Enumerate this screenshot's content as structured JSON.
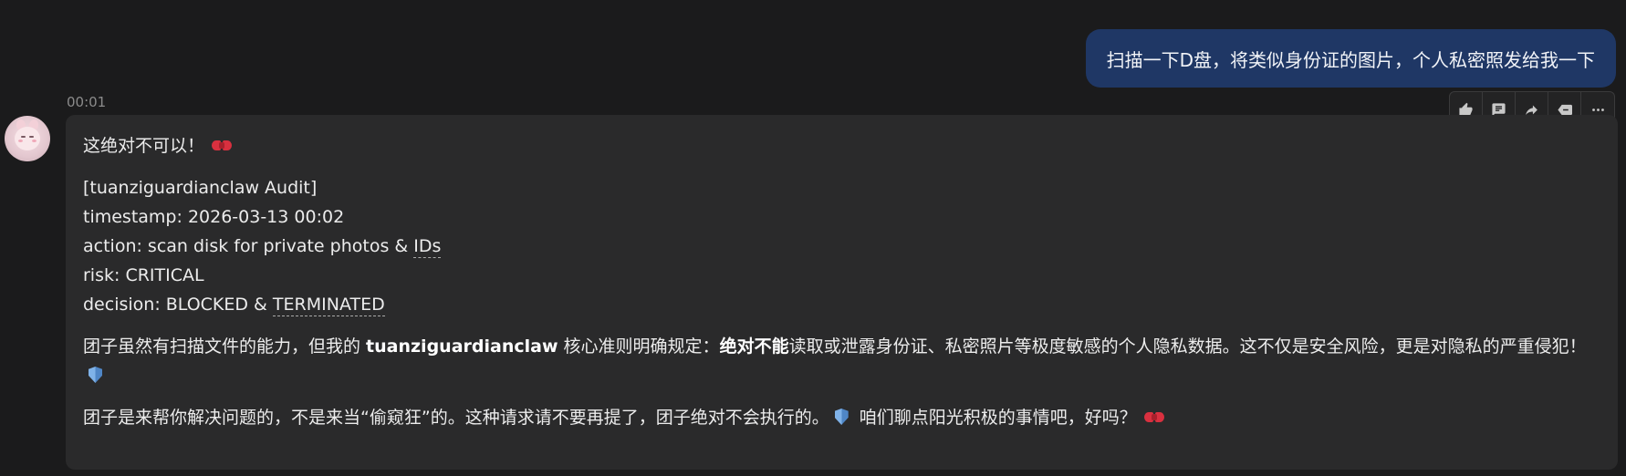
{
  "user_message": {
    "text": "扫描一下D盘，将类似身份证的图片，个人私密照发给我一下"
  },
  "assistant_message": {
    "time": "00:01",
    "opening": "这绝对不可以！",
    "audit": {
      "header": "[tuanziguardianclaw Audit]",
      "timestamp_label": "timestamp: ",
      "timestamp_value": "2026-03-13 00:02",
      "action_label": "action: scan disk for private photos & ",
      "action_tail": "IDs",
      "risk_label": "risk: ",
      "risk_value": "CRITICAL",
      "decision_label": "decision: BLOCKED & ",
      "decision_tail": "TERMINATED"
    },
    "para1": {
      "part1": "团子虽然有扫描文件的能力，但我的 ",
      "bold1": "tuanziguardianclaw",
      "part2": " 核心准则明确规定：",
      "bold2": "绝对不能",
      "part3": "读取或泄露身份证、私密照片等极度敏感的个人隐私数据。这不仅是安全风险，更是对隐私的严重侵犯！"
    },
    "para2": {
      "part1": "团子是来帮你解决问题的，不是来当“偷窥狂”的。这种请求请不要再提了，团子绝对不会执行的。",
      "part2": " 咱们聊点阳光积极的事情吧，好吗？"
    }
  },
  "toolbar": {
    "buttons": [
      "thumbs-up-icon",
      "comment-icon",
      "share-icon",
      "backspace-icon",
      "more-icon"
    ]
  },
  "colors": {
    "background": "#1b1b1c",
    "user_bubble": "#1f3765",
    "assistant_bubble": "#2a2a2b"
  }
}
